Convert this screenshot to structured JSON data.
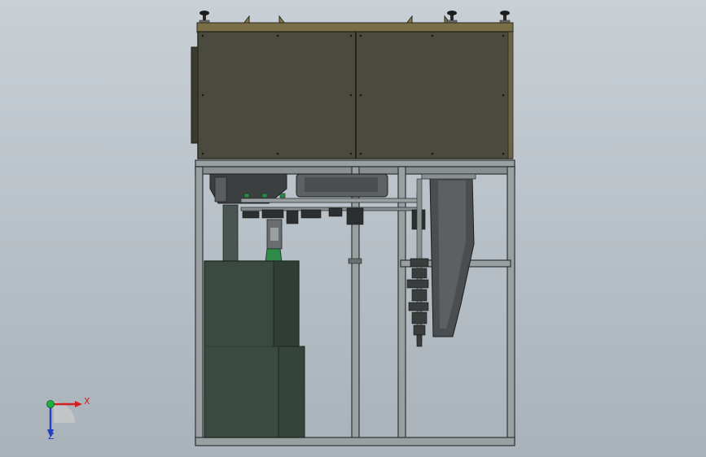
{
  "viewport": {
    "background_top": "#c8d0d6",
    "background_bottom": "#a9b2b9"
  },
  "colors": {
    "enclosure": "#4a4a3e",
    "enclosure_edge": "#2a2a22",
    "bracket": "#8a7a48",
    "frame": "#9aa0a2",
    "frame_edge": "#2e3234",
    "cabinet": "#3a4a40",
    "cabinet_shade": "#2f3d35",
    "mechanism_dark": "#3c3f40",
    "mechanism_mid": "#6a6e70",
    "green_part": "#2f8a4a",
    "axis_x": "#d02020",
    "axis_y": "#20b040",
    "axis_z": "#2040c0"
  },
  "triad": {
    "x_label": "X",
    "z_label": "Z",
    "x_icon": "x-axis-arrow-icon",
    "y_icon": "y-axis-origin-icon",
    "z_icon": "z-axis-arrow-icon"
  }
}
